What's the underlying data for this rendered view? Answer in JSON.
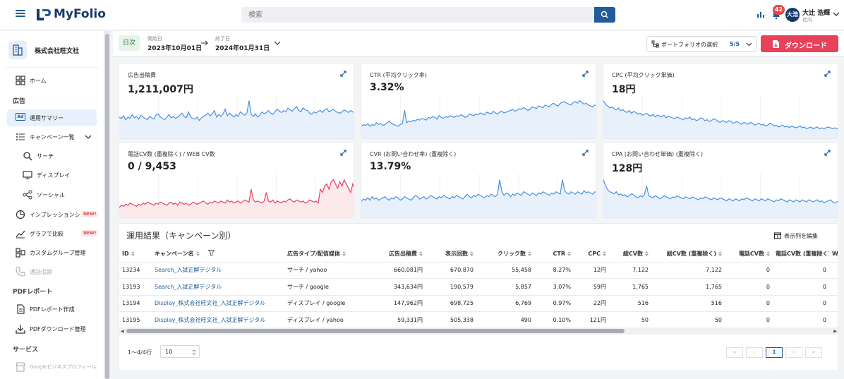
{
  "app": {
    "name": "MyFolio",
    "brand_color": "#163a6b",
    "accent": "#1f5c99",
    "danger": "#e8415a"
  },
  "header": {
    "search_placeholder": "検索",
    "notification_count": "42",
    "user": {
      "initials": "大浩",
      "name": "大辻 浩輝",
      "role": "社内"
    }
  },
  "sidebar": {
    "company": "株式会社旺文社",
    "home": "ホーム",
    "section_ads": "広告",
    "ops_summary": "運用サマリー",
    "campaign_list": "キャンペーン一覧",
    "search": "サーチ",
    "display": "ディスプレイ",
    "social": "ソーシャル",
    "impression_share": "インプレッションシェ",
    "graph_compare": "グラフで比較",
    "new_badge": "NEW!",
    "custom_group": "カスタムグループ管理",
    "call_tracking": "通話追跡",
    "section_pdf": "PDFレポート",
    "pdf_create": "PDFレポート作成",
    "pdf_download": "PDFダウンロード管理",
    "section_service": "サービス",
    "google_business": "Googleビジネスプロフィール"
  },
  "toolbar": {
    "granularity": "日次",
    "start_label": "開始日",
    "start_date": "2023年10月01日",
    "end_label": "終了日",
    "end_date": "2024年01月31日",
    "portfolio_label": "ポートフォリオの選択",
    "portfolio_count": "5/5",
    "download": "ダウンロード"
  },
  "metrics": [
    {
      "title": "広告出稿費",
      "value": "1,211,007円"
    },
    {
      "title": "CTR (平均クリック率)",
      "value": "3.32%"
    },
    {
      "title": "CPC (平均クリック単価)",
      "value": "18円"
    },
    {
      "title": "電話CV数 (重複除く) / WEB CV数",
      "value": "0 / 9,453"
    },
    {
      "title": "CVR (お問い合わせ率) (重複除く)",
      "value": "13.79%"
    },
    {
      "title": "CPA (お問い合わせ単価) (重複除く)",
      "value": "128円"
    }
  ],
  "sparklines": [
    {
      "color": "#4a90e2",
      "fill": "#e8f1fb",
      "values": [
        30,
        28,
        32,
        26,
        30,
        28,
        34,
        29,
        31,
        27,
        33,
        30,
        28,
        26,
        31,
        29,
        27,
        33,
        35,
        30,
        28,
        26,
        30,
        34,
        29,
        31,
        28,
        30,
        33,
        36,
        31,
        29,
        38,
        30,
        28,
        27,
        30,
        25,
        29,
        31,
        33,
        36,
        32,
        35,
        40,
        30,
        34,
        31,
        35,
        42,
        32,
        36,
        33,
        30,
        34,
        31,
        38,
        35,
        33,
        36,
        55,
        34,
        31,
        35,
        30,
        33,
        38,
        35,
        37,
        40,
        36,
        34,
        38,
        42,
        39,
        37,
        40,
        38,
        44,
        41,
        39,
        43,
        46,
        40,
        38,
        44,
        41,
        40,
        36,
        34,
        38,
        36,
        39,
        40,
        37,
        41,
        43,
        38,
        40,
        42,
        39,
        37,
        36,
        38,
        41,
        39,
        37,
        40,
        38,
        36
      ]
    },
    {
      "color": "#4a90e2",
      "fill": "#e8f1fb",
      "values": [
        12,
        14,
        13,
        15,
        12,
        14,
        13,
        16,
        14,
        15,
        13,
        14,
        16,
        18,
        15,
        14,
        13,
        12,
        14,
        15,
        30,
        16,
        18,
        17,
        19,
        18,
        20,
        19,
        21,
        20,
        19,
        22,
        21,
        23,
        22,
        20,
        24,
        22,
        21,
        23,
        22,
        24,
        23,
        22,
        24,
        23,
        25,
        24,
        22,
        23,
        26,
        25,
        24,
        26,
        25,
        27,
        26,
        25,
        28,
        27,
        26,
        29,
        27,
        26,
        28,
        29,
        27,
        28,
        29,
        30,
        31,
        29,
        30,
        32,
        31,
        33,
        32,
        30,
        31,
        34,
        33,
        32,
        35,
        34,
        33,
        36,
        35,
        34,
        37,
        38,
        36,
        35,
        38,
        39,
        40,
        38,
        37,
        36,
        39,
        40,
        38,
        41,
        39,
        37,
        38,
        36,
        35,
        34,
        36,
        35
      ]
    },
    {
      "color": "#4a90e2",
      "fill": "#e8f1fb",
      "values": [
        40,
        36,
        34,
        32,
        33,
        31,
        30,
        32,
        29,
        30,
        28,
        27,
        29,
        26,
        28,
        27,
        25,
        26,
        24,
        25,
        26,
        24,
        23,
        25,
        22,
        24,
        23,
        22,
        24,
        21,
        23,
        22,
        21,
        20,
        22,
        21,
        20,
        19,
        21,
        20,
        22,
        19,
        20,
        18,
        19,
        21,
        20,
        18,
        19,
        17,
        18,
        20,
        19,
        17,
        16,
        18,
        17,
        16,
        18,
        17,
        15,
        16,
        17,
        15,
        14,
        16,
        15,
        14,
        16,
        15,
        13,
        14,
        15,
        13,
        14,
        12,
        13,
        15,
        14,
        12,
        13,
        11,
        12,
        13,
        11,
        12,
        10,
        12,
        11,
        10,
        11,
        12,
        10,
        11,
        9,
        10,
        11,
        9,
        10,
        11,
        9,
        10,
        9,
        10,
        11,
        10,
        9,
        10,
        9,
        10
      ]
    },
    {
      "color": "#e8415a",
      "fill": "#fde9ec",
      "values": [
        8,
        10,
        9,
        11,
        10,
        12,
        11,
        10,
        9,
        11,
        10,
        12,
        11,
        13,
        12,
        11,
        10,
        12,
        11,
        13,
        12,
        11,
        10,
        12,
        13,
        11,
        12,
        10,
        13,
        12,
        11,
        12,
        10,
        11,
        13,
        12,
        11,
        12,
        13,
        14,
        12,
        11,
        13,
        12,
        14,
        13,
        12,
        14,
        13,
        12,
        15,
        13,
        14,
        12,
        13,
        14,
        12,
        13,
        15,
        14,
        13,
        25,
        15,
        13,
        14,
        13,
        12,
        14,
        22,
        14,
        13,
        15,
        12,
        14,
        13,
        12,
        14,
        13,
        15,
        16,
        14,
        13,
        15,
        14,
        13,
        14,
        12,
        13,
        15,
        14,
        13,
        14,
        12,
        25,
        22,
        28,
        30,
        25,
        32,
        34,
        30,
        26,
        32,
        28,
        34,
        30,
        26,
        22,
        30,
        24
      ]
    },
    {
      "color": "#4a90e2",
      "fill": "#e8f1fb",
      "values": [
        12,
        14,
        13,
        15,
        13,
        16,
        14,
        15,
        13,
        14,
        15,
        16,
        14,
        13,
        15,
        14,
        16,
        15,
        13,
        14,
        16,
        15,
        14,
        13,
        15,
        17,
        16,
        14,
        15,
        16,
        14,
        15,
        17,
        16,
        15,
        14,
        16,
        15,
        17,
        16,
        15,
        14,
        16,
        15,
        17,
        16,
        15,
        14,
        16,
        18,
        16,
        15,
        17,
        16,
        18,
        17,
        16,
        15,
        17,
        16,
        18,
        17,
        16,
        18,
        30,
        20,
        17,
        19,
        18,
        16,
        18,
        17,
        19,
        18,
        17,
        20,
        19,
        18,
        17,
        19,
        18,
        17,
        19,
        18,
        20,
        19,
        18,
        17,
        19,
        18,
        20,
        19,
        18,
        30,
        21,
        19,
        18,
        20,
        19,
        18,
        20,
        19,
        18,
        21,
        19,
        20,
        19,
        18,
        20,
        19
      ]
    },
    {
      "color": "#4a90e2",
      "fill": "#e8f1fb",
      "values": [
        36,
        30,
        26,
        24,
        23,
        22,
        24,
        21,
        22,
        20,
        21,
        19,
        20,
        22,
        21,
        19,
        18,
        20,
        19,
        21,
        30,
        20,
        19,
        18,
        20,
        19,
        17,
        18,
        20,
        19,
        18,
        17,
        19,
        18,
        20,
        19,
        18,
        17,
        19,
        18,
        17,
        19,
        18,
        17,
        16,
        18,
        17,
        19,
        18,
        17,
        16,
        18,
        17,
        16,
        18,
        17,
        16,
        15,
        17,
        16,
        15,
        17,
        16,
        15,
        17,
        16,
        18,
        17,
        16,
        15,
        17,
        16,
        15,
        17,
        16,
        15,
        17,
        16,
        15,
        14,
        16,
        15,
        17,
        16,
        15,
        14,
        16,
        15,
        14,
        16,
        15,
        14,
        16,
        15,
        14,
        16,
        15,
        14,
        15,
        16,
        14,
        15,
        13,
        14,
        15,
        16,
        14,
        13,
        14,
        15
      ]
    }
  ],
  "table": {
    "title": "運用結果（キャンペーン別）",
    "edit_columns": "表示列を編集",
    "columns": [
      "ID",
      "キャンペーン名",
      "広告タイプ/配信媒体",
      "広告出稿費",
      "表示回数",
      "クリック数",
      "CTR",
      "CPC",
      "総CV数",
      "総CV数 (重複除く)",
      "電話CV数",
      "電話CV数 (重複除く)",
      "W"
    ],
    "rows": [
      [
        "13234",
        "Search_入試正解デジタル",
        "サーチ / yahoo",
        "660,081円",
        "670,870",
        "55,458",
        "8.27%",
        "12円",
        "7,122",
        "7,122",
        "0",
        "0"
      ],
      [
        "13193",
        "Search_入試正解デジタル",
        "サーチ / google",
        "343,634円",
        "190,579",
        "5,857",
        "3.07%",
        "59円",
        "1,765",
        "1,765",
        "0",
        "0"
      ],
      [
        "13194",
        "Display_株式会社旺文社_入試正解デジタル",
        "ディスプレイ / google",
        "147,962円",
        "698,725",
        "6,769",
        "0.97%",
        "22円",
        "516",
        "516",
        "0",
        "0"
      ],
      [
        "13195",
        "Display_株式会社旺文社_入試正解デジタル",
        "ディスプレイ / yahoo",
        "59,331円",
        "505,338",
        "490",
        "0.10%",
        "121円",
        "50",
        "50",
        "0",
        "0"
      ]
    ],
    "row_count": "1〜4/4行",
    "per_page": "10",
    "current_page": "1"
  }
}
